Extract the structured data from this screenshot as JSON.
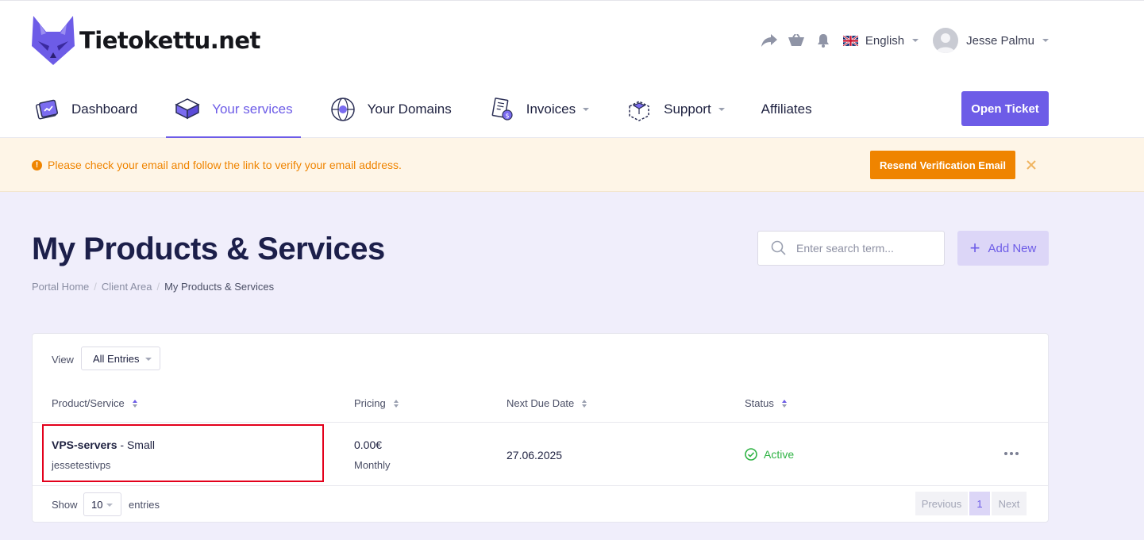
{
  "brand": {
    "name": "Tietokettu.net"
  },
  "header": {
    "language": "English",
    "user_name": "Jesse Palmu",
    "icons": [
      "share-icon",
      "basket-icon",
      "bell-icon"
    ]
  },
  "nav": {
    "items": [
      {
        "label": "Dashboard",
        "icon": "dashboard-icon"
      },
      {
        "label": "Your services",
        "icon": "services-icon"
      },
      {
        "label": "Your Domains",
        "icon": "globe-icon"
      },
      {
        "label": "Invoices",
        "icon": "invoice-icon"
      },
      {
        "label": "Support",
        "icon": "support-icon"
      },
      {
        "label": "Affiliates"
      }
    ],
    "active": "Your services",
    "open_ticket": "Open Ticket"
  },
  "alert": {
    "message": "Please check your email and follow the link to verify your email address.",
    "resend_label": "Resend Verification Email"
  },
  "page": {
    "title": "My Products & Services",
    "breadcrumb": [
      "Portal Home",
      "Client Area",
      "My Products & Services"
    ],
    "search_placeholder": "Enter search term...",
    "add_new": "Add New"
  },
  "table": {
    "view_label": "View",
    "view_value": "All Entries",
    "columns": [
      "Product/Service",
      "Pricing",
      "Next Due Date",
      "Status"
    ],
    "rows": [
      {
        "product": "VPS-servers",
        "plan": "- Small",
        "domain": "jessetestivps",
        "price": "0.00€",
        "cycle": "Monthly",
        "due": "27.06.2025",
        "status": "Active"
      }
    ],
    "show_label": "Show",
    "show_value": "10",
    "entries_label": "entries",
    "pagination": {
      "previous": "Previous",
      "page": "1",
      "next": "Next"
    }
  },
  "colors": {
    "accent": "#6d5ce7",
    "warning": "#ef8400",
    "success": "#2fb344",
    "highlight": "#e3001b"
  }
}
